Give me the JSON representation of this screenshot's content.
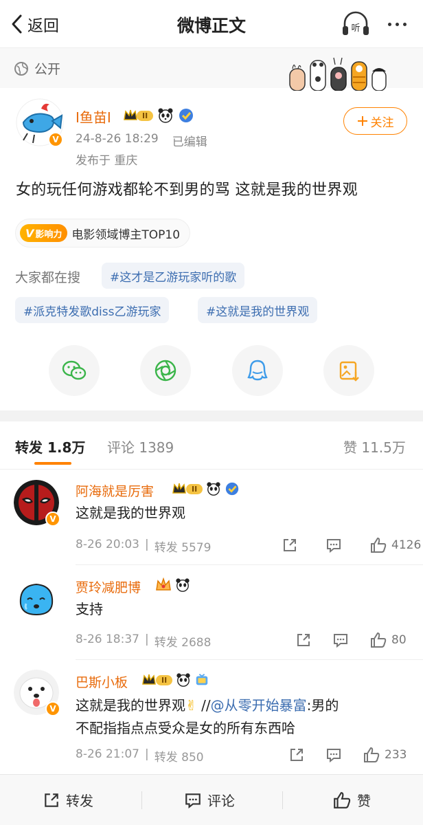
{
  "header": {
    "back_label": "返回",
    "title": "微博正文",
    "listen_label": "听"
  },
  "visibility": {
    "label": "公开"
  },
  "post": {
    "username": "I鱼苗I",
    "level_badge": "II",
    "date": "24-8-26 18:29",
    "edited": "已编辑",
    "location": "发布于 重庆",
    "follow_label": "关注",
    "text": "女的玩任何游戏都轮不到男的骂 这就是我的世界观",
    "influence_badge": "影响力",
    "influence_text": "电影领域博主TOP10",
    "search_label": "大家都在搜",
    "topics": [
      "#这才是乙游玩家听的歌",
      "#派克特发歌diss乙游玩家",
      "#这就是我的世界观"
    ]
  },
  "tabs": {
    "repost_label": "转发",
    "repost_count": "1.8万",
    "comment_label": "评论",
    "comment_count": "1389",
    "like_label": "赞",
    "like_count": "11.5万"
  },
  "reposts": [
    {
      "name": "阿海就是厉害",
      "level": "II",
      "text": "这就是我的世界观",
      "time": "8-26 20:03",
      "repost": "转发 5579",
      "likes": "4126"
    },
    {
      "name": "贾玲减肥博",
      "level": "",
      "text": "支持",
      "time": "8-26 18:37",
      "repost": "转发 2688",
      "likes": "80"
    },
    {
      "name": "巴斯小板",
      "level": "II",
      "text_main": "这就是我的世界观",
      "text_sep": " //",
      "mention": "@从零开始暴富",
      "text_rest": ":男的",
      "text_line2": "不配指指点点受众是女的所有东西哈",
      "time": "8-26 21:07",
      "repost": "转发 850",
      "likes": "233"
    }
  ],
  "bottom": {
    "repost": "转发",
    "comment": "评论",
    "like": "赞"
  },
  "colors": {
    "accent": "#ff8200",
    "username": "#e86b0c",
    "link": "#3c6db0"
  }
}
